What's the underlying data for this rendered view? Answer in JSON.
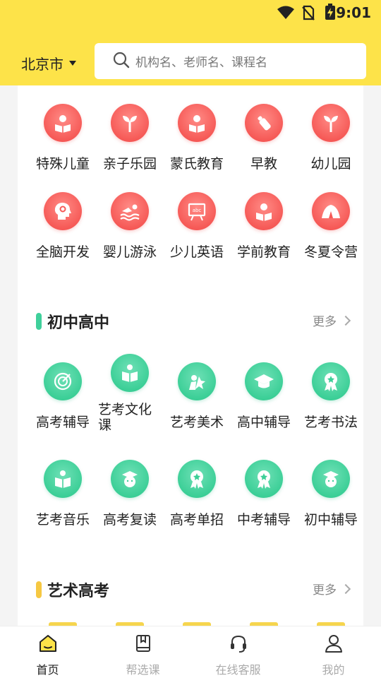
{
  "status_bar": {
    "time": "9:01"
  },
  "header": {
    "city": "北京市",
    "search_placeholder": "机构名、老师名、课程名"
  },
  "preschool": {
    "items": [
      {
        "label": "特殊儿童",
        "icon": "reading-child-icon"
      },
      {
        "label": "亲子乐园",
        "icon": "sprout-icon"
      },
      {
        "label": "蒙氏教育",
        "icon": "reading-child-icon"
      },
      {
        "label": "早教",
        "icon": "baby-bottle-icon"
      },
      {
        "label": "幼儿园",
        "icon": "sprout-icon"
      },
      {
        "label": "全脑开发",
        "icon": "brain-gears-icon"
      },
      {
        "label": "婴儿游泳",
        "icon": "swimmer-icon"
      },
      {
        "label": "少儿英语",
        "icon": "abc-board-icon"
      },
      {
        "label": "学前教育",
        "icon": "reading-child-icon"
      },
      {
        "label": "冬夏令营",
        "icon": "tent-icon"
      }
    ]
  },
  "middle_high": {
    "title": "初中高中",
    "more": "更多",
    "accent": "#3fd09b",
    "items": [
      {
        "label": "高考辅导",
        "icon": "target-icon"
      },
      {
        "label": "艺考文化课",
        "icon": "book-person-icon"
      },
      {
        "label": "艺考美术",
        "icon": "puzzle-icon"
      },
      {
        "label": "高中辅导",
        "icon": "graduation-cap-icon"
      },
      {
        "label": "艺考书法",
        "icon": "medal-icon"
      },
      {
        "label": "艺考音乐",
        "icon": "book-person-icon"
      },
      {
        "label": "高考复读",
        "icon": "grad-student-icon"
      },
      {
        "label": "高考单招",
        "icon": "medal-icon"
      },
      {
        "label": "中考辅导",
        "icon": "medal-icon"
      },
      {
        "label": "初中辅导",
        "icon": "grad-student-icon"
      }
    ]
  },
  "art_exam": {
    "title": "艺术高考",
    "more": "更多",
    "accent": "#f6c842"
  },
  "tabbar": {
    "tabs": [
      {
        "label": "首页",
        "icon": "home-icon",
        "active": true
      },
      {
        "label": "帮选课",
        "icon": "book-icon",
        "active": false
      },
      {
        "label": "在线客服",
        "icon": "headset-icon",
        "active": false
      },
      {
        "label": "我的",
        "icon": "user-icon",
        "active": false
      }
    ]
  }
}
